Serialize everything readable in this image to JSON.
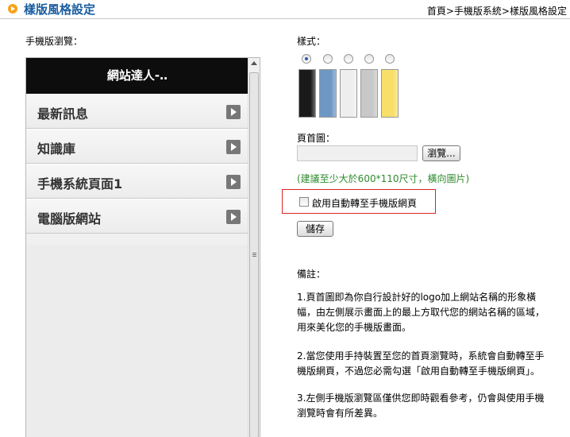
{
  "header": {
    "title": "樣版風格設定",
    "breadcrumb": [
      "首頁",
      "手機版系統",
      "樣版風格設定"
    ],
    "breadcrumb_separator": ">"
  },
  "preview": {
    "label": "手機版瀏覽：",
    "site_title": "網站達人-‥",
    "menu_items": [
      "最新訊息",
      "知識庫",
      "手機系統頁面1",
      "電腦版網站"
    ]
  },
  "style": {
    "label": "樣式：",
    "selected_index": 0,
    "swatches": [
      {
        "name": "black",
        "color": "#1a1a1a"
      },
      {
        "name": "blue",
        "color": "#6f97c4"
      },
      {
        "name": "white",
        "color": "#eeeeee"
      },
      {
        "name": "gray",
        "color": "#c8c8c8"
      },
      {
        "name": "yellow",
        "color": "#f7df6a"
      }
    ]
  },
  "banner": {
    "label": "頁首圖：",
    "file_value": "",
    "browse_label": "瀏覽...",
    "hint": "(建議至少大於600*110尺寸，橫向圖片)"
  },
  "auto_redirect": {
    "label": "啟用自動轉至手機版網頁",
    "checked": false
  },
  "save_label": "儲存",
  "notes": {
    "title": "備註：",
    "items": [
      "1.頁首圖即為你自行設計好的logo加上網站名稱的形象橫幅，由左側展示畫面上的最上方取代您的網站名稱的區域，用來美化您的手機版畫面。",
      "2.當您使用手持裝置至您的首頁瀏覽時，系統會自動轉至手機版網頁，不過您必需勾選「啟用自動轉至手機版網頁」。",
      "3.左側手機版瀏覽區僅供您即時觀看參考，仍會與使用手機瀏覽時會有所差異。"
    ]
  }
}
